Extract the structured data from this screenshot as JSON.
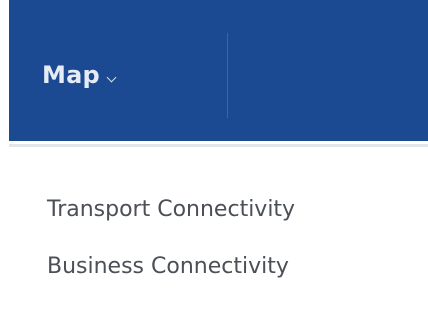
{
  "nav": {
    "label": "Map",
    "chevron_icon": "chevron-down-icon",
    "background": "#1b4a92"
  },
  "dropdown": {
    "items": [
      {
        "label": "Transport Connectivity"
      },
      {
        "label": "Business Connectivity"
      }
    ]
  }
}
